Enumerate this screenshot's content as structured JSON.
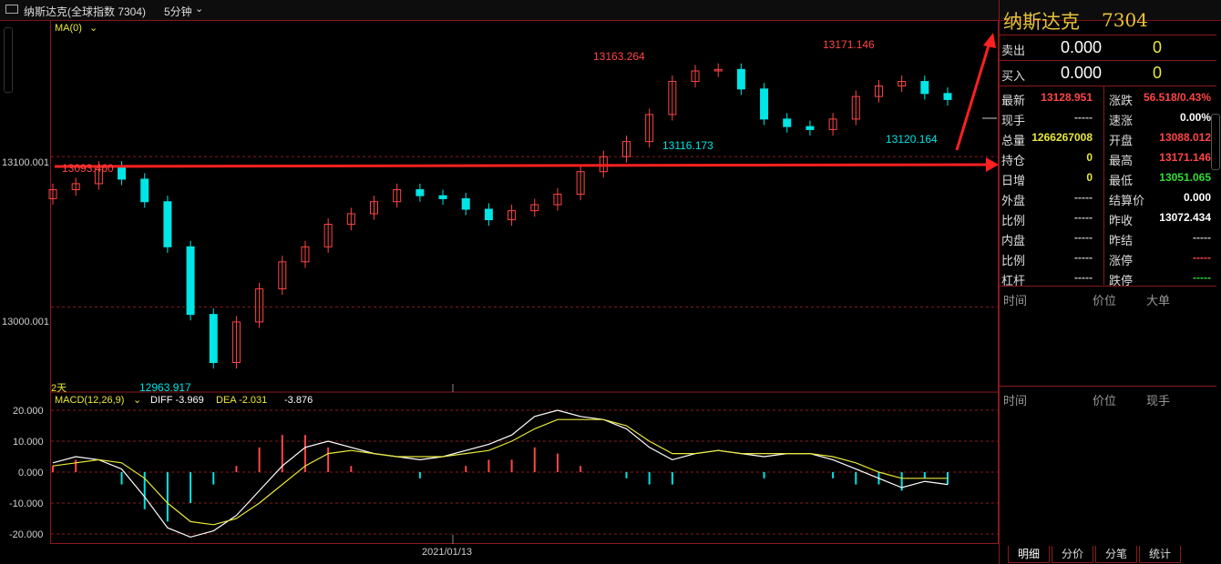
{
  "title_bar": {
    "icon": "tile-layout-icon",
    "name": "纳斯达克(全球指数 7304)",
    "period": "5分钟"
  },
  "chart": {
    "ma_label": "MA(0)",
    "day_label": "2天",
    "date_label": "2021/01/13",
    "price_axis": [
      "13100.001",
      "13000.001"
    ],
    "annotations": {
      "hline_label": "13093.460",
      "peak1": "13163.264",
      "peak2": "13171.146",
      "trough1": "13116.173",
      "trough2": "13120.164",
      "low": "12963.917"
    },
    "macd": {
      "label": "MACD(12,26,9)",
      "diff": "DIFF -3.969",
      "dea": "DEA -2.031",
      "value": "-3.876",
      "axis": [
        "20.000",
        "10.000",
        "0.000",
        "-10.000",
        "-20.000"
      ]
    }
  },
  "chart_data": {
    "type": "line",
    "title": "",
    "xlabel": "",
    "ylabel": "",
    "x": [
      1,
      2,
      3,
      4,
      5,
      6,
      7,
      8,
      9,
      10,
      11,
      12,
      13,
      14,
      15,
      16,
      17,
      18,
      19,
      20,
      21,
      22,
      23,
      24,
      25,
      26,
      27,
      28,
      29,
      30,
      31,
      32,
      33,
      34,
      35,
      36,
      37,
      38,
      39,
      40
    ],
    "series": [
      {
        "values": [
          13078,
          13082,
          13093,
          13085,
          13070,
          13040,
          12995,
          12963,
          12990,
          13012,
          13030,
          13040,
          13055,
          13062,
          13070,
          13078,
          13074,
          13072,
          13065,
          13058,
          13064,
          13068,
          13075,
          13090,
          13100,
          13110,
          13128,
          13150,
          13157,
          13158,
          13145,
          13125,
          13120,
          13118,
          13125,
          13140,
          13147,
          13150,
          13142,
          13138
        ]
      }
    ],
    "ylim": [
      12950,
      13180
    ],
    "grid": true,
    "macd_series": [
      {
        "name": "DIFF",
        "values": [
          3,
          5,
          4,
          1,
          -8,
          -18,
          -21,
          -19,
          -14,
          -6,
          2,
          8,
          10,
          8,
          6,
          5,
          4,
          5,
          7,
          9,
          12,
          18,
          20,
          18,
          17,
          14,
          8,
          4,
          6,
          7,
          6,
          5,
          6,
          6,
          4,
          1,
          -2,
          -5,
          -3,
          -4
        ]
      },
      {
        "name": "DEA",
        "values": [
          2,
          3,
          4,
          3,
          -2,
          -10,
          -16,
          -17,
          -15,
          -10,
          -4,
          2,
          6,
          7,
          6,
          5,
          5,
          5,
          6,
          7,
          10,
          14,
          17,
          17,
          17,
          15,
          10,
          6,
          6,
          7,
          6,
          6,
          6,
          6,
          5,
          3,
          0,
          -2,
          -2,
          -2
        ]
      }
    ],
    "macd_ylim": [
      -20,
      20
    ]
  },
  "quote": {
    "name": "纳斯达克",
    "code": "7304",
    "sell": {
      "label": "卖出",
      "price": "0.000",
      "vol": "0"
    },
    "buy": {
      "label": "买入",
      "price": "0.000",
      "vol": "0"
    },
    "rows": [
      {
        "k1": "最新",
        "v1": "13128.951",
        "c1": "#ff4545",
        "k2": "涨跌",
        "v2": "56.518/0.43%",
        "c2": "#ff4545"
      },
      {
        "k1": "现手",
        "v1": "-----",
        "c1": "#bbbbbb",
        "k2": "速涨",
        "v2": "0.00%",
        "c2": "#ffffff"
      },
      {
        "k1": "总量",
        "v1": "1266267008",
        "c1": "#e8e83a",
        "k2": "开盘",
        "v2": "13088.012",
        "c2": "#ff4545"
      },
      {
        "k1": "持仓",
        "v1": "0",
        "c1": "#e8e83a",
        "k2": "最高",
        "v2": "13171.146",
        "c2": "#ff4545"
      },
      {
        "k1": "日增",
        "v1": "0",
        "c1": "#e8e83a",
        "k2": "最低",
        "v2": "13051.065",
        "c2": "#33dd33"
      },
      {
        "k1": "外盘",
        "v1": "-----",
        "c1": "#bbbbbb",
        "k2": "结算价",
        "v2": "0.000",
        "c2": "#ffffff"
      },
      {
        "k1": "比例",
        "v1": "-----",
        "c1": "#bbbbbb",
        "k2": "昨收",
        "v2": "13072.434",
        "c2": "#ffffff"
      },
      {
        "k1": "内盘",
        "v1": "-----",
        "c1": "#bbbbbb",
        "k2": "昨结",
        "v2": "-----",
        "c2": "#bbbbbb"
      },
      {
        "k1": "比例",
        "v1": "-----",
        "c1": "#bbbbbb",
        "k2": "涨停",
        "v2": "-----",
        "c2": "#ff4545"
      },
      {
        "k1": "杠杆",
        "v1": "-----",
        "c1": "#bbbbbb",
        "k2": "跌停",
        "v2": "-----",
        "c2": "#33dd33"
      }
    ]
  },
  "ticks_top": {
    "c1": "时间",
    "c2": "价位",
    "c3": "大单"
  },
  "ticks_bottom": {
    "c1": "时间",
    "c2": "价位",
    "c3": "现手"
  },
  "tabs": [
    "明细",
    "分价",
    "分笔",
    "统计"
  ],
  "colors": {
    "up": "#ff4545",
    "down": "#00e5e5",
    "grid": "#8b1a1a",
    "yellow": "#e8e83a",
    "accent": "#ff2020"
  }
}
